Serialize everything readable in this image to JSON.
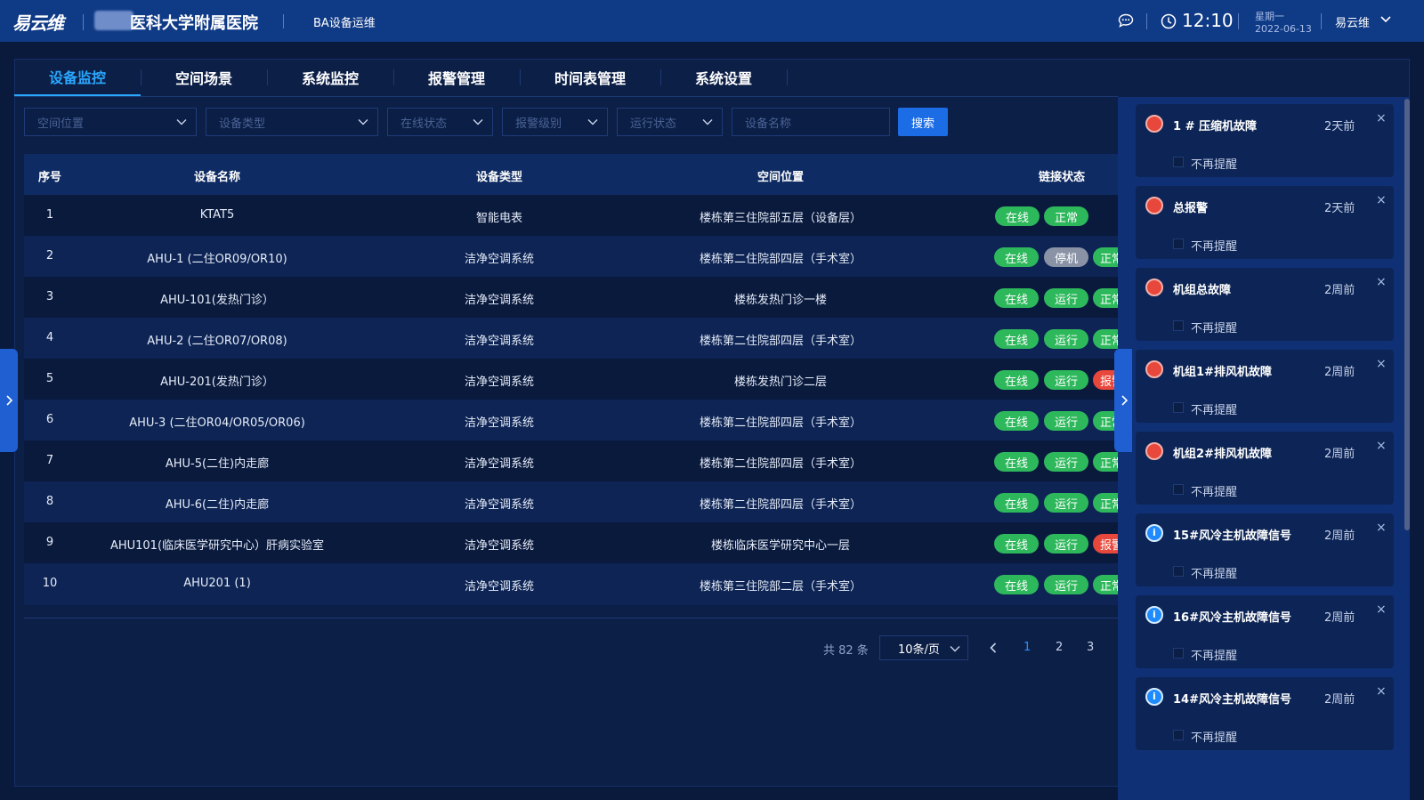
{
  "header": {
    "logo": "易云维",
    "hospital_name": "医科大学附属医院",
    "system_name": "BA设备运维",
    "time": "12:10",
    "weekday": "星期一",
    "date": "2022-06-13",
    "user": "易云维"
  },
  "tabs": [
    "设备监控",
    "空间场景",
    "系统监控",
    "报警管理",
    "时间表管理",
    "系统设置"
  ],
  "filters": {
    "space": "空间位置",
    "device_type": "设备类型",
    "online_status": "在线状态",
    "alarm_level": "报警级别",
    "run_status": "运行状态",
    "device_name": "设备名称",
    "search_button": "搜索"
  },
  "table": {
    "columns": [
      "序号",
      "设备名称",
      "设备类型",
      "空间位置",
      "链接状态"
    ],
    "rows": [
      {
        "no": "1",
        "name": "KTAT5",
        "type": "智能电表",
        "location": "楼栋第三住院部五层（设备层）",
        "tags": [
          "在线",
          "正常"
        ]
      },
      {
        "no": "2",
        "name": "AHU-1 (二住OR09/OR10)",
        "type": "洁净空调系统",
        "location": "楼栋第二住院部四层（手术室）",
        "tags": [
          "在线",
          "停机",
          "正常"
        ]
      },
      {
        "no": "3",
        "name": "AHU-101(发热门诊）",
        "type": "洁净空调系统",
        "location": "楼栋发热门诊一楼",
        "tags": [
          "在线",
          "运行",
          "正常"
        ]
      },
      {
        "no": "4",
        "name": "AHU-2 (二住OR07/OR08)",
        "type": "洁净空调系统",
        "location": "楼栋第二住院部四层（手术室）",
        "tags": [
          "在线",
          "运行",
          "正常"
        ]
      },
      {
        "no": "5",
        "name": "AHU-201(发热门诊）",
        "type": "洁净空调系统",
        "location": "楼栋发热门诊二层",
        "tags": [
          "在线",
          "运行",
          "报警"
        ]
      },
      {
        "no": "6",
        "name": "AHU-3 (二住OR04/OR05/OR06)",
        "type": "洁净空调系统",
        "location": "楼栋第二住院部四层（手术室）",
        "tags": [
          "在线",
          "运行",
          "正常"
        ]
      },
      {
        "no": "7",
        "name": "AHU-5(二住)内走廊",
        "type": "洁净空调系统",
        "location": "楼栋第二住院部四层（手术室）",
        "tags": [
          "在线",
          "运行",
          "正常"
        ]
      },
      {
        "no": "8",
        "name": "AHU-6(二住)内走廊",
        "type": "洁净空调系统",
        "location": "楼栋第二住院部四层（手术室）",
        "tags": [
          "在线",
          "运行",
          "正常"
        ]
      },
      {
        "no": "9",
        "name": "AHU101(临床医学研究中心）肝病实验室",
        "type": "洁净空调系统",
        "location": "楼栋临床医学研究中心一层",
        "tags": [
          "在线",
          "运行",
          "报警"
        ]
      },
      {
        "no": "10",
        "name": "AHU201 (1)",
        "type": "洁净空调系统",
        "location": "楼栋第三住院部二层（手术室）",
        "tags": [
          "在线",
          "运行",
          "正常"
        ]
      }
    ]
  },
  "pagination": {
    "total": "共 82 条",
    "page_size": "10条/页",
    "pages": [
      "1",
      "2",
      "3"
    ]
  },
  "alarms": [
    {
      "title": "1 # 压缩机故障",
      "ago": "2天前",
      "level": "red",
      "dismiss": "不再提醒"
    },
    {
      "title": "总报警",
      "ago": "2天前",
      "level": "red",
      "dismiss": "不再提醒"
    },
    {
      "title": "机组总故障",
      "ago": "2周前",
      "level": "red",
      "dismiss": "不再提醒"
    },
    {
      "title": "机组1#排风机故障",
      "ago": "2周前",
      "level": "red",
      "dismiss": "不再提醒"
    },
    {
      "title": "机组2#排风机故障",
      "ago": "2周前",
      "level": "red",
      "dismiss": "不再提醒"
    },
    {
      "title": "15#风冷主机故障信号",
      "ago": "2周前",
      "level": "info",
      "dismiss": "不再提醒"
    },
    {
      "title": "16#风冷主机故障信号",
      "ago": "2周前",
      "level": "info",
      "dismiss": "不再提醒"
    },
    {
      "title": "14#风冷主机故障信号",
      "ago": "2周前",
      "level": "info",
      "dismiss": "不再提醒"
    }
  ],
  "colors": {
    "online": "#2eb85c",
    "running": "#2eb85c",
    "normal": "#2eb85c",
    "stopped": "#8a93a6",
    "alarm": "#e8473b",
    "accent": "#2aa8ff"
  }
}
